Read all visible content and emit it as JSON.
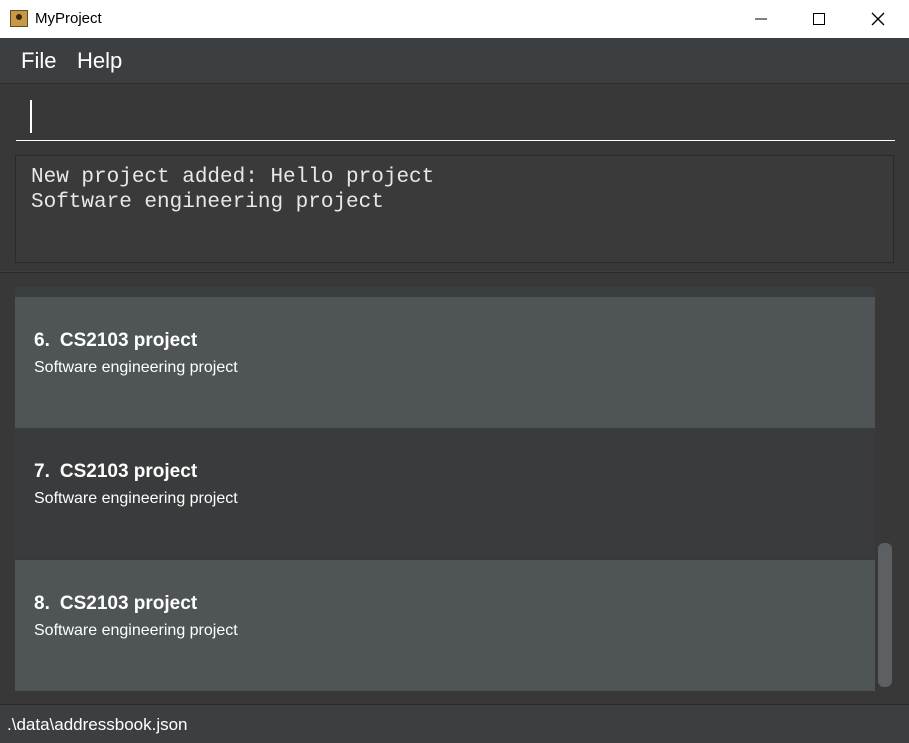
{
  "window": {
    "title": "MyProject",
    "icon": "address-book-icon",
    "controls": [
      "minimize-icon",
      "maximize-icon",
      "close-icon"
    ]
  },
  "menu": {
    "items": [
      {
        "label": "File"
      },
      {
        "label": "Help"
      }
    ]
  },
  "command": {
    "value": ""
  },
  "result": {
    "text": "New project added: Hello project\nSoftware engineering project"
  },
  "projects": [
    {
      "index": "6.",
      "name": "CS2103 project",
      "description": "Software engineering project"
    },
    {
      "index": "7.",
      "name": "CS2103 project",
      "description": "Software engineering project"
    },
    {
      "index": "8.",
      "name": "CS2103 project",
      "description": "Software engineering project"
    }
  ],
  "status": {
    "path": ".\\data\\addressbook.json"
  },
  "colors": {
    "background": "#3c3f41",
    "card_light": "#4f5456",
    "card_dark": "#3a3b3c",
    "text": "#ffffff"
  }
}
